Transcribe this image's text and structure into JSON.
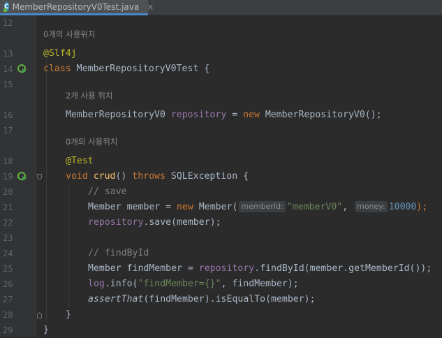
{
  "tab": {
    "icon_letter": "C",
    "filename": "MemberRepositoryV0Test.java",
    "close": "×"
  },
  "usage_hints": {
    "line12": "0개의 사용위치",
    "line15": "2개 사용 위치",
    "line17": "0개의 사용위치"
  },
  "line_numbers": [
    "12",
    "13",
    "14",
    "15",
    "16",
    "17",
    "18",
    "19",
    "20",
    "21",
    "22",
    "23",
    "24",
    "25",
    "26",
    "27",
    "28",
    "29"
  ],
  "code": {
    "l13": {
      "annotation": "@Slf4j"
    },
    "l14": {
      "kw": "class",
      "rest": " MemberRepositoryV0Test {"
    },
    "l16": {
      "type": "MemberRepositoryV0 ",
      "field": "repository",
      "eq": " = ",
      "kw": "new",
      "rest": " MemberRepositoryV0();"
    },
    "l18": {
      "annotation": "@Test"
    },
    "l19": {
      "kw1": "void ",
      "method": "crud",
      "mid": "() ",
      "kw2": "throws",
      "rest": " SQLException {"
    },
    "l20": {
      "comment": "// save"
    },
    "l21": {
      "pre": "Member member = ",
      "kw": "new",
      "mid": " Member(",
      "hint1": "memberId:",
      "str": "\"memberV0\"",
      "comma": ", ",
      "hint2": "money:",
      "num": "10000",
      "end": ");"
    },
    "l22": {
      "field": "repository",
      "rest": ".save(member);"
    },
    "l24": {
      "comment": "// findById"
    },
    "l25": {
      "pre": "Member findMember = ",
      "field": "repository",
      "rest": ".findById(member.getMemberId());"
    },
    "l26": {
      "field": "log",
      "mid": ".info(",
      "str": "\"findMember={}\"",
      "rest": ", findMember);"
    },
    "l27": {
      "method": "assertThat",
      "rest": "(findMember).isEqualTo(member);"
    },
    "l28": {
      "brace": "}"
    },
    "l29": {
      "brace": "}"
    }
  },
  "colors": {
    "background": "#2b2b2b",
    "gutter": "#313335",
    "keyword": "#cc7832",
    "annotation": "#bbb529",
    "field": "#9876aa",
    "string": "#6a8759",
    "number": "#6897bb",
    "comment": "#808080",
    "method": "#ffc66d",
    "text": "#a9b7c6"
  },
  "icons": [
    "java-class-icon",
    "run-test-icon",
    "fold-marker-icon"
  ]
}
